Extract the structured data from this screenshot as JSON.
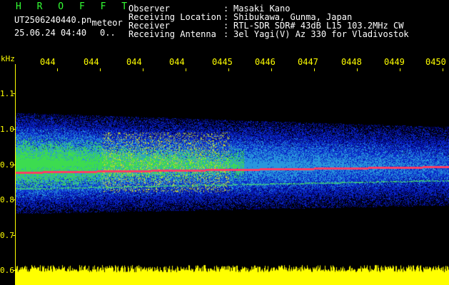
{
  "header": {
    "app_title": "H R O F F T",
    "filename": "UT2506240440.pn",
    "filename_suffix": "meteor",
    "datetime": "25.06.24 04:40",
    "counter": "0..",
    "rows": [
      {
        "label": "Observer",
        "value": "Masaki Kano"
      },
      {
        "label": "Receiving Location",
        "value": "Shibukawa, Gunma, Japan"
      },
      {
        "label": "Receiver",
        "value": "RTL-SDR SDR# 43dB L15 103.2MHz CW"
      },
      {
        "label": "Receiving Antenna",
        "value": "3el Yagi(V) Az 330 for Vladivostok"
      }
    ]
  },
  "axes": {
    "y_unit": "kHz",
    "x_ticks": [
      "044",
      "044",
      "044",
      "044",
      "0445",
      "0446",
      "0447",
      "0448",
      "0449",
      "0450"
    ],
    "y_ticks": [
      "1.1",
      "1.0",
      "0.9",
      "0.8",
      "0.7",
      "0.6"
    ]
  },
  "colors": {
    "background": "#000000",
    "axis": "#ffff00",
    "title": "#33ff33",
    "text": "#ffffff",
    "signal": "#ff3366"
  }
}
